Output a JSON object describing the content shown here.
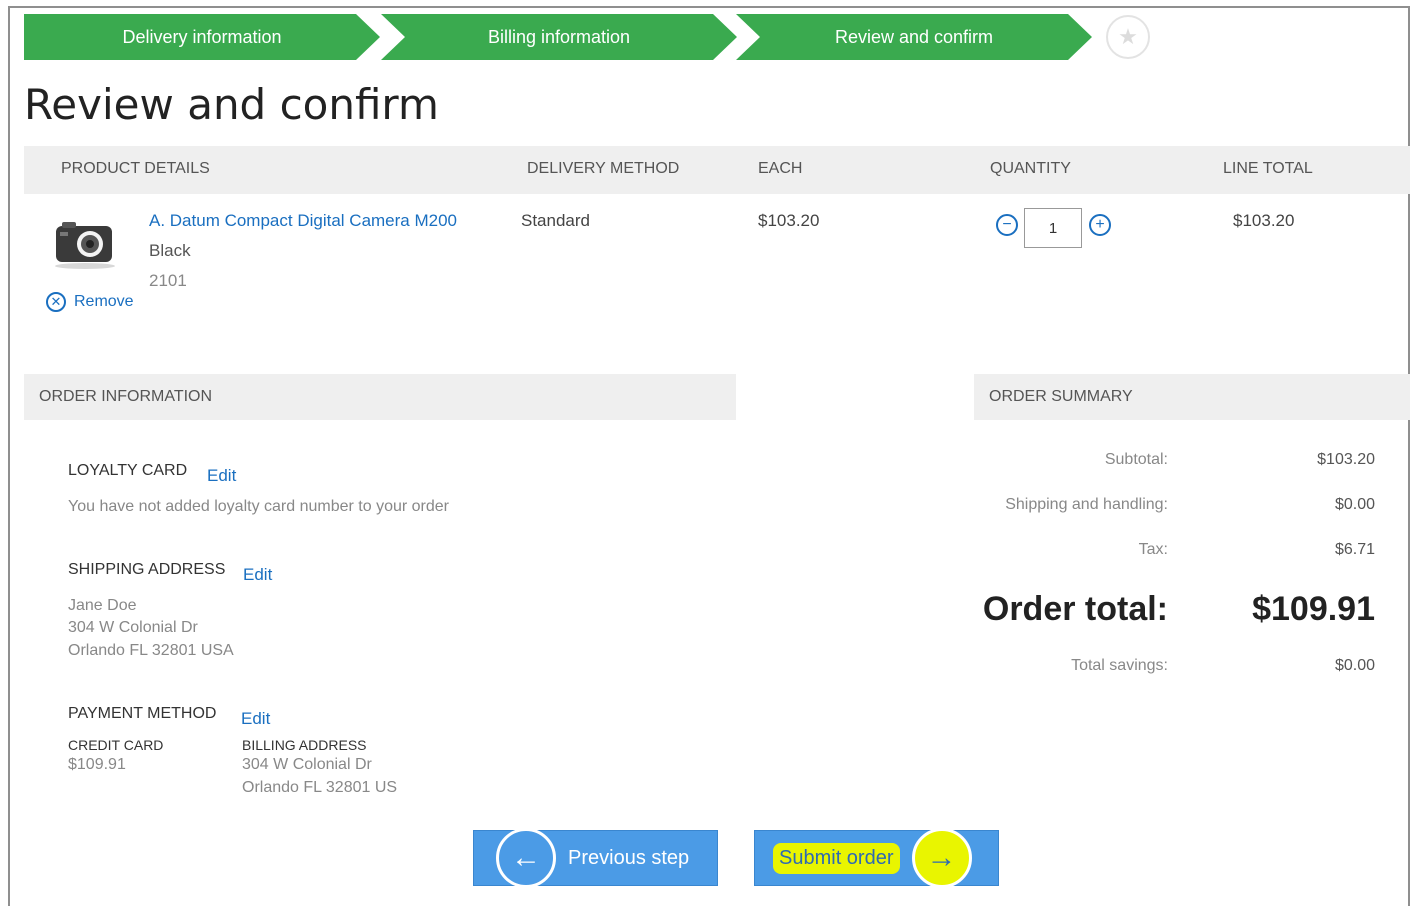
{
  "steps": {
    "step1": "Delivery information",
    "step2": "Billing information",
    "step3": "Review and confirm",
    "final_icon": "star-icon"
  },
  "page_title": "Review and confirm",
  "cart": {
    "headers": {
      "product": "PRODUCT DETAILS",
      "delivery": "DELIVERY METHOD",
      "each": "EACH",
      "quantity": "QUANTITY",
      "line_total": "LINE TOTAL"
    },
    "item": {
      "name": "A. Datum Compact Digital Camera M200",
      "color": "Black",
      "number": "2101",
      "remove_label": "Remove",
      "delivery": "Standard",
      "each": "$103.20",
      "quantity": "1",
      "line_total": "$103.20"
    }
  },
  "order_info": {
    "header": "ORDER INFORMATION",
    "loyalty": {
      "title": "LOYALTY CARD",
      "edit": "Edit",
      "text": "You have not added loyalty card number to your order"
    },
    "shipping": {
      "title": "SHIPPING ADDRESS",
      "edit": "Edit",
      "name": "Jane Doe",
      "line1": "304 W Colonial Dr",
      "line2": "Orlando FL 32801 USA"
    },
    "payment": {
      "title": "PAYMENT METHOD",
      "edit": "Edit",
      "card_title": "CREDIT CARD",
      "card_amount": "$109.91",
      "billing_title": "BILLING ADDRESS",
      "billing_line1": "304 W Colonial Dr",
      "billing_line2": "Orlando FL 32801 US"
    }
  },
  "summary": {
    "header": "ORDER SUMMARY",
    "subtotal_label": "Subtotal:",
    "subtotal": "$103.20",
    "shipping_label": "Shipping and handling:",
    "shipping": "$0.00",
    "tax_label": "Tax:",
    "tax": "$6.71",
    "total_label": "Order total:",
    "total": "$109.91",
    "savings_label": "Total savings:",
    "savings": "$0.00"
  },
  "buttons": {
    "previous": "Previous step",
    "submit": "Submit order"
  },
  "colors": {
    "step_green": "#3aaa4f",
    "link_blue": "#1a6fc0",
    "button_blue": "#4b9be6",
    "highlight_yellow": "#e9f500"
  }
}
